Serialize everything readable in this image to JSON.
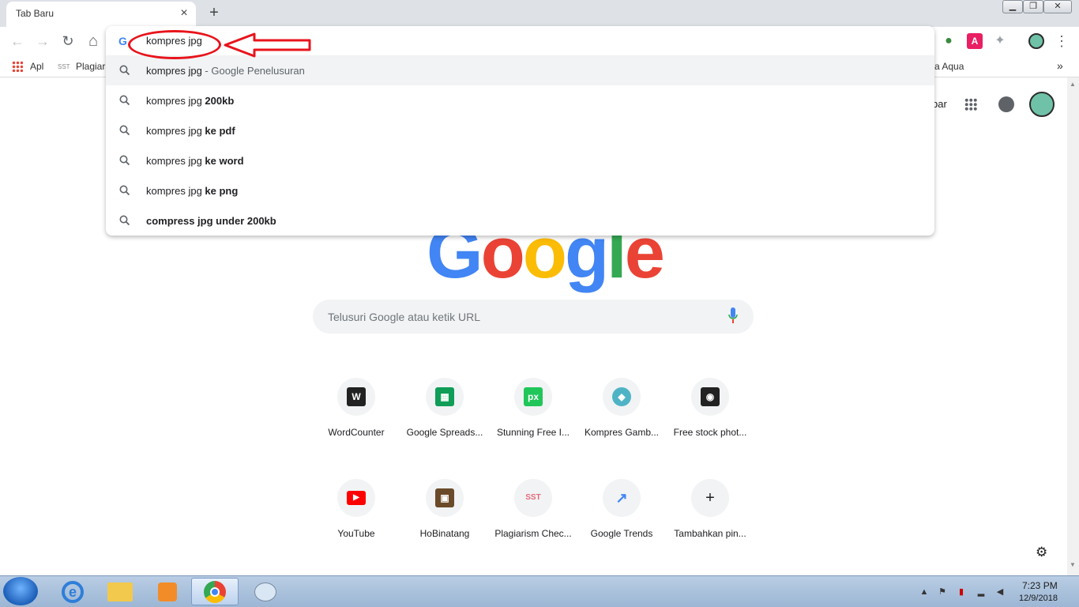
{
  "browser": {
    "tab_title": "Tab Baru",
    "tab_close": "×",
    "new_tab": "+",
    "window_buttons": {
      "minimize": "▁",
      "restore": "❐",
      "close": "✕"
    }
  },
  "toolbar": {
    "back": "←",
    "forward": "→",
    "reload": "↻",
    "home": "⌂",
    "omnibox_value": "kompres jpg",
    "extensions": [
      {
        "name": "extension-globe",
        "glyph": "●",
        "color": "#3b8a3e"
      },
      {
        "name": "extension-a",
        "glyph": "A",
        "color": "#e91e63"
      },
      {
        "name": "extension-puzzle",
        "glyph": "✦",
        "color": "#9aa0a6"
      }
    ],
    "more": "⋮"
  },
  "bookmarks": {
    "apps_label": "Apl",
    "items": [
      {
        "icon": "SST",
        "label": "Plagiari"
      }
    ],
    "right_label": "a Aqua",
    "overflow": "»"
  },
  "dropdown": {
    "suggestions": [
      {
        "typed": "kompres jpg",
        "bold": "",
        "suffix": " - Google Penelusuran",
        "highlighted": true
      },
      {
        "typed": "kompres jpg ",
        "bold": "200kb",
        "suffix": "",
        "highlighted": false
      },
      {
        "typed": "kompres jpg ",
        "bold": "ke pdf",
        "suffix": "",
        "highlighted": false
      },
      {
        "typed": "kompres jpg ",
        "bold": "ke word",
        "suffix": "",
        "highlighted": false
      },
      {
        "typed": "kompres jpg ",
        "bold": "ke png",
        "suffix": "",
        "highlighted": false
      },
      {
        "typed": "",
        "bold": "compress jpg under 200kb",
        "suffix": "",
        "highlighted": false
      }
    ]
  },
  "ntp": {
    "partial_link": "bar",
    "search_placeholder": "Telusuri Google atau ketik URL",
    "logo_text": "Google",
    "tiles_row1": [
      {
        "label": "WordCounter",
        "icon": "W",
        "bg": "#222222"
      },
      {
        "label": "Google Spreads...",
        "icon": "▦",
        "bg": "#0f9d58"
      },
      {
        "label": "Stunning Free I...",
        "icon": "px",
        "bg": "#20c659"
      },
      {
        "label": "Kompres Gamb...",
        "icon": "◆",
        "bg": "#4fb3c6"
      },
      {
        "label": "Free stock phot...",
        "icon": "◉",
        "bg": "#222222"
      }
    ],
    "tiles_row2": [
      {
        "label": "YouTube",
        "icon": "▶",
        "bg": "#ff0000"
      },
      {
        "label": "HoBinatang",
        "icon": "▣",
        "bg": "#6b4a2a"
      },
      {
        "label": "Plagiarism Chec...",
        "icon": "SST",
        "bg": "#f1f3f4"
      },
      {
        "label": "Google Trends",
        "icon": "↗",
        "bg": "#f1f3f4"
      },
      {
        "label": "Tambahkan pin...",
        "icon": "+",
        "bg": "#f1f3f4"
      }
    ],
    "settings_icon": "⚙"
  },
  "taskbar": {
    "time": "7:23 PM",
    "date": "12/9/2018"
  },
  "colors": {
    "annotation_red": "#e8141c",
    "google_blue": "#4285f4",
    "google_red": "#ea4335",
    "google_yellow": "#fbbc05",
    "google_green": "#34a853"
  }
}
